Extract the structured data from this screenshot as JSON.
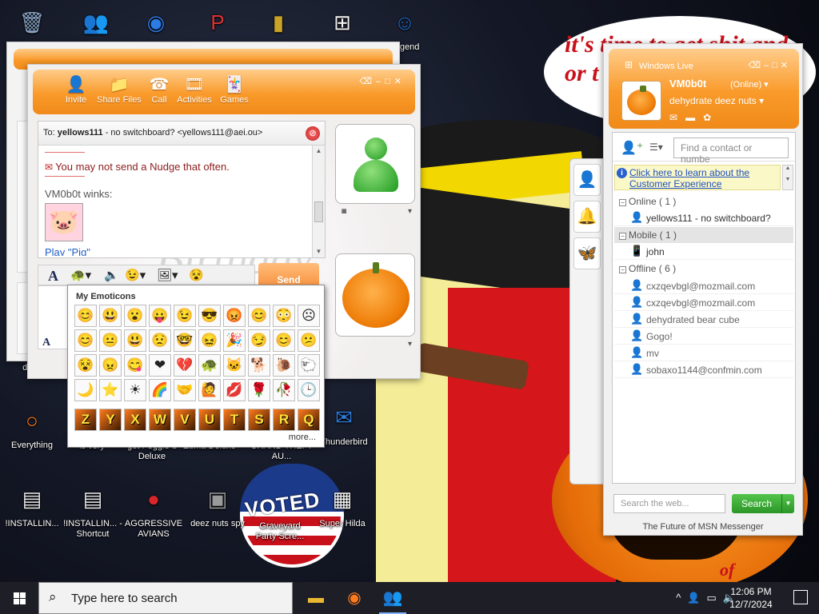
{
  "wallpaper": {
    "bubble_text": "it's time to get shit and or t",
    "badge_text": "VOTED",
    "bottom_text": "of"
  },
  "desktop_icons": [
    {
      "label": "",
      "icon": "recycle-bin-icon",
      "glyph": "🗑",
      "color": "#8aa7c7"
    },
    {
      "label": "",
      "icon": "messenger-icon",
      "glyph": "👥",
      "color": "#3c9b2d"
    },
    {
      "label": "",
      "icon": "chrome-icon",
      "glyph": "◉",
      "color": "#2c7be5"
    },
    {
      "label": "",
      "icon": "app-icon",
      "glyph": "P",
      "color": "#d83333"
    },
    {
      "label": "",
      "icon": "folder-icon",
      "glyph": "▮",
      "color": "#c9a227"
    },
    {
      "label": "",
      "icon": "windows-icon",
      "glyph": "⊞",
      "color": "#f3f3f3"
    },
    {
      "label": "Legend",
      "icon": "game-icon",
      "glyph": "☺",
      "color": "#1e6bc5"
    },
    {
      "label": "does",
      "icon": "",
      "glyph": "",
      "color": ""
    },
    {
      "label": "Everything",
      "icon": "search-app-icon",
      "glyph": "○",
      "color": "#ff7b1c"
    },
    {
      "label": "is very",
      "icon": "",
      "glyph": "",
      "color": ""
    },
    {
      "label": "get Peggle d Deluxe",
      "icon": "",
      "glyph": "",
      "color": ""
    },
    {
      "label": "Zuma Deluxe",
      "icon": "",
      "glyph": "",
      "color": ""
    },
    {
      "label": "GRAND THEFT AU...",
      "icon": "",
      "glyph": "",
      "color": ""
    },
    {
      "label": "Thunderbird",
      "icon": "thunderbird-icon",
      "glyph": "✉",
      "color": "#2d7ee0"
    },
    {
      "label": "!INSTALLIN...",
      "icon": "document-icon",
      "glyph": "▤",
      "color": "#e9e9e9"
    },
    {
      "label": "!INSTALLIN... - Shortcut",
      "icon": "document-shortcut-icon",
      "glyph": "▤",
      "color": "#e9e9e9"
    },
    {
      "label": "AGGRESSIVE AVIANS",
      "icon": "angry-bird-icon",
      "glyph": "●",
      "color": "#d6262a"
    },
    {
      "label": "deez nuts spy",
      "icon": "windows-stack-icon",
      "glyph": "▣",
      "color": "#9a9a9a"
    },
    {
      "label": "Graveyard Party Scre...",
      "icon": "",
      "glyph": "",
      "color": ""
    },
    {
      "label": "Super Hilda",
      "icon": "pixel-art-icon",
      "glyph": "▦",
      "color": "#f3f3f3"
    }
  ],
  "conversation": {
    "toolbar": [
      {
        "label": "Invite",
        "glyph": "👤"
      },
      {
        "label": "Share Files",
        "glyph": "📁"
      },
      {
        "label": "Call",
        "glyph": "☎"
      },
      {
        "label": "Activities",
        "glyph": "🎞"
      },
      {
        "label": "Games",
        "glyph": "🃏"
      }
    ],
    "to_label": "To:",
    "to_name": "yellows111",
    "to_rest": " - no switchboard? <yellows111@aei.ou>",
    "nudge_text": "You may not send a Nudge that often.",
    "wink_sender": "VM0b0t winks:",
    "play_link": "Play \"Pig\"",
    "watermark": "Happy Birthday",
    "send_label": "Send"
  },
  "emoticons": {
    "title": "My Emoticons",
    "items": [
      "😊",
      "😃",
      "😮",
      "😛",
      "😉",
      "😎",
      "😡",
      "😊",
      "😳",
      "☹",
      "😊",
      "😐",
      "😃",
      "😟",
      "🤓",
      "😖",
      "🎉",
      "😏",
      "😊",
      "😕",
      "😵",
      "😠",
      "😋",
      "❤",
      "💔",
      "🐢",
      "🐱",
      "🐕",
      "🐌",
      "🐑",
      "🌙",
      "⭐",
      "☀",
      "🌈",
      "🤝",
      "🙋",
      "💋",
      "🌹",
      "🥀",
      "🕒"
    ],
    "letters": [
      "Z",
      "Y",
      "X",
      "W",
      "V",
      "U",
      "T",
      "S",
      "R",
      "Q"
    ],
    "more": "more..."
  },
  "contact_list": {
    "title": "Windows Live",
    "self_name": "VM0b0t",
    "self_status": "(Online)",
    "self_psm": "dehydrate deez nuts",
    "find_placeholder": "Find a contact or numbe",
    "cx_link": "Click here to learn about the Customer Experience",
    "groups": {
      "online": "Online ( 1 )",
      "mobile": "Mobile ( 1 )",
      "offline": "Offline ( 6 )"
    },
    "online": [
      "yellows111 - no switchboard?"
    ],
    "mobile": [
      "john"
    ],
    "offline": [
      "cxzqevbgl@mozmail.com",
      "cxzqevbgl@mozmail.com",
      "dehydrated bear cube",
      "Gogo!",
      "mv",
      "sobaxo1144@confmin.com"
    ],
    "web_placeholder": "Search the web...",
    "search_label": "Search",
    "footer": "The Future of MSN Messenger"
  },
  "taskbar": {
    "search_text": "Type here to search",
    "time": "12:06 PM",
    "date": "12/7/2024"
  }
}
